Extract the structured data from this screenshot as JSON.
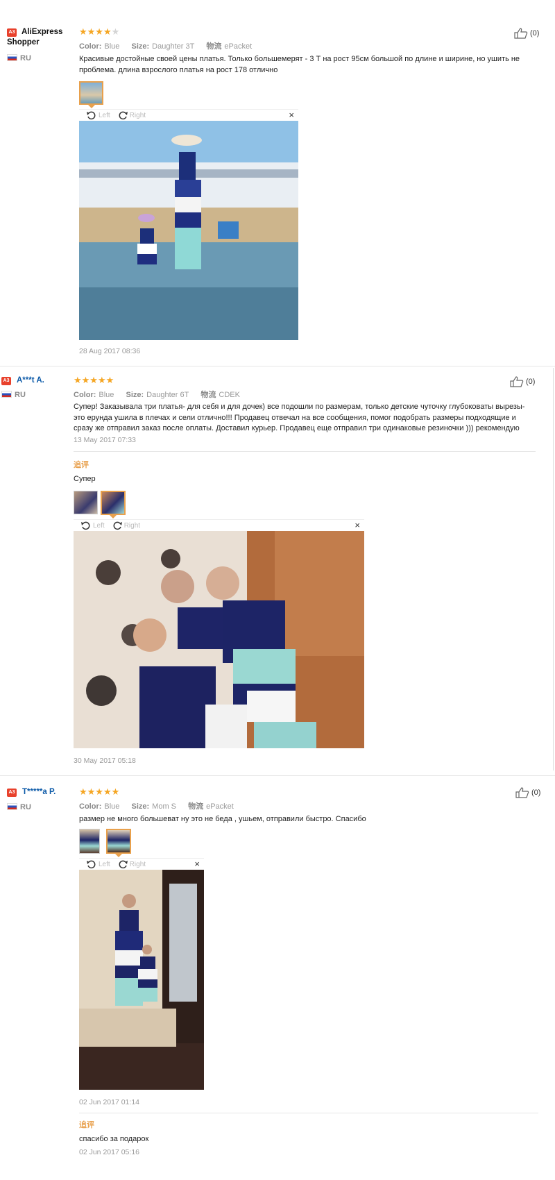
{
  "reviews": [
    {
      "badge": "A3",
      "name": "AliExpress Shopper",
      "country": "RU",
      "rating": 4,
      "color_label": "Color:",
      "color_value": "Blue",
      "size_label": "Size:",
      "size_value": "Daughter 3T",
      "ship_label": "物流",
      "ship_value": "ePacket",
      "text": "Красивые достойные своей цены платья. Только большемерят - 3 Т на рост 95см большой по длине и ширине, но ушить не проблема. длина взрослого платья на рост 178 отлично",
      "date": "28 Aug 2017 08:36",
      "likes": "(0)",
      "viewer_left": "Left",
      "viewer_right": "Right",
      "viewer_close": "×"
    },
    {
      "badge": "A3",
      "name": "A***t A.",
      "country": "RU",
      "rating": 5,
      "color_label": "Color:",
      "color_value": "Blue",
      "size_label": "Size:",
      "size_value": "Daughter 6T",
      "ship_label": "物流",
      "ship_value": "CDEK",
      "text": "Супер! Заказывала три платья- для себя и для дочек) все подошли по размерам, только детские чуточку глубоковаты вырезы- это ерунда ушила в плечах и сели отлично!!! Продавец отвечал на все сообщения, помог подобрать размеры подходящие и сразу же отправил заказ после оплаты. Доставил курьер. Продавец еще отправил три одинаковые резиночки ))) рекомендую",
      "date": "13 May 2017 07:33",
      "likes": "(0)",
      "addl_title": "追评",
      "addl_text": "Супер",
      "addl_date": "30 May 2017 05:18",
      "viewer_left": "Left",
      "viewer_right": "Right",
      "viewer_close": "×"
    },
    {
      "badge": "A3",
      "name": "T*****a P.",
      "country": "RU",
      "rating": 5,
      "color_label": "Color:",
      "color_value": "Blue",
      "size_label": "Size:",
      "size_value": "Mom S",
      "ship_label": "物流",
      "ship_value": "ePacket",
      "text": "размер не много большеват ну это не беда , ушьем, отправили быстро. Спасибо",
      "date": "02 Jun 2017 01:14",
      "likes": "(0)",
      "addl_title": "追评",
      "addl_text": "спасибо за подарок",
      "addl_date": "02 Jun 2017 05:16",
      "viewer_left": "Left",
      "viewer_right": "Right",
      "viewer_close": "×"
    }
  ]
}
